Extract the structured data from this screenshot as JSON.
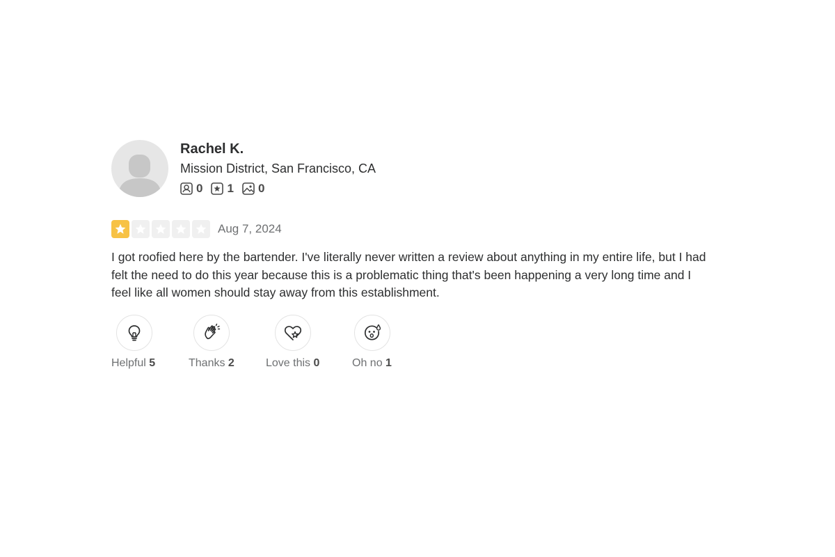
{
  "user": {
    "name": "Rachel K.",
    "location": "Mission District, San Francisco, CA",
    "stats": [
      {
        "icon": "friends-icon",
        "count": "0"
      },
      {
        "icon": "reviews-icon",
        "count": "1"
      },
      {
        "icon": "photos-icon",
        "count": "0"
      }
    ]
  },
  "review": {
    "rating": 1,
    "max_rating": 5,
    "date": "Aug 7, 2024",
    "text": "I got roofied here by the bartender. I've literally never written a review about anything in my entire life, but I had felt the need to do this year because this is a problematic thing that's been happening a very long time and I feel like all women should stay away from this establishment."
  },
  "reactions": [
    {
      "icon": "lightbulb-icon",
      "label": "Helpful",
      "count": "5"
    },
    {
      "icon": "clapping-hands-icon",
      "label": "Thanks",
      "count": "2"
    },
    {
      "icon": "heart-icon",
      "label": "Love this",
      "count": "0"
    },
    {
      "icon": "oh-no-face-icon",
      "label": "Oh no",
      "count": "1"
    }
  ],
  "colors": {
    "star_filled": "#f7c245",
    "star_empty": "#f0f0f0",
    "text": "#2d2e2f",
    "muted": "#6e7072"
  }
}
